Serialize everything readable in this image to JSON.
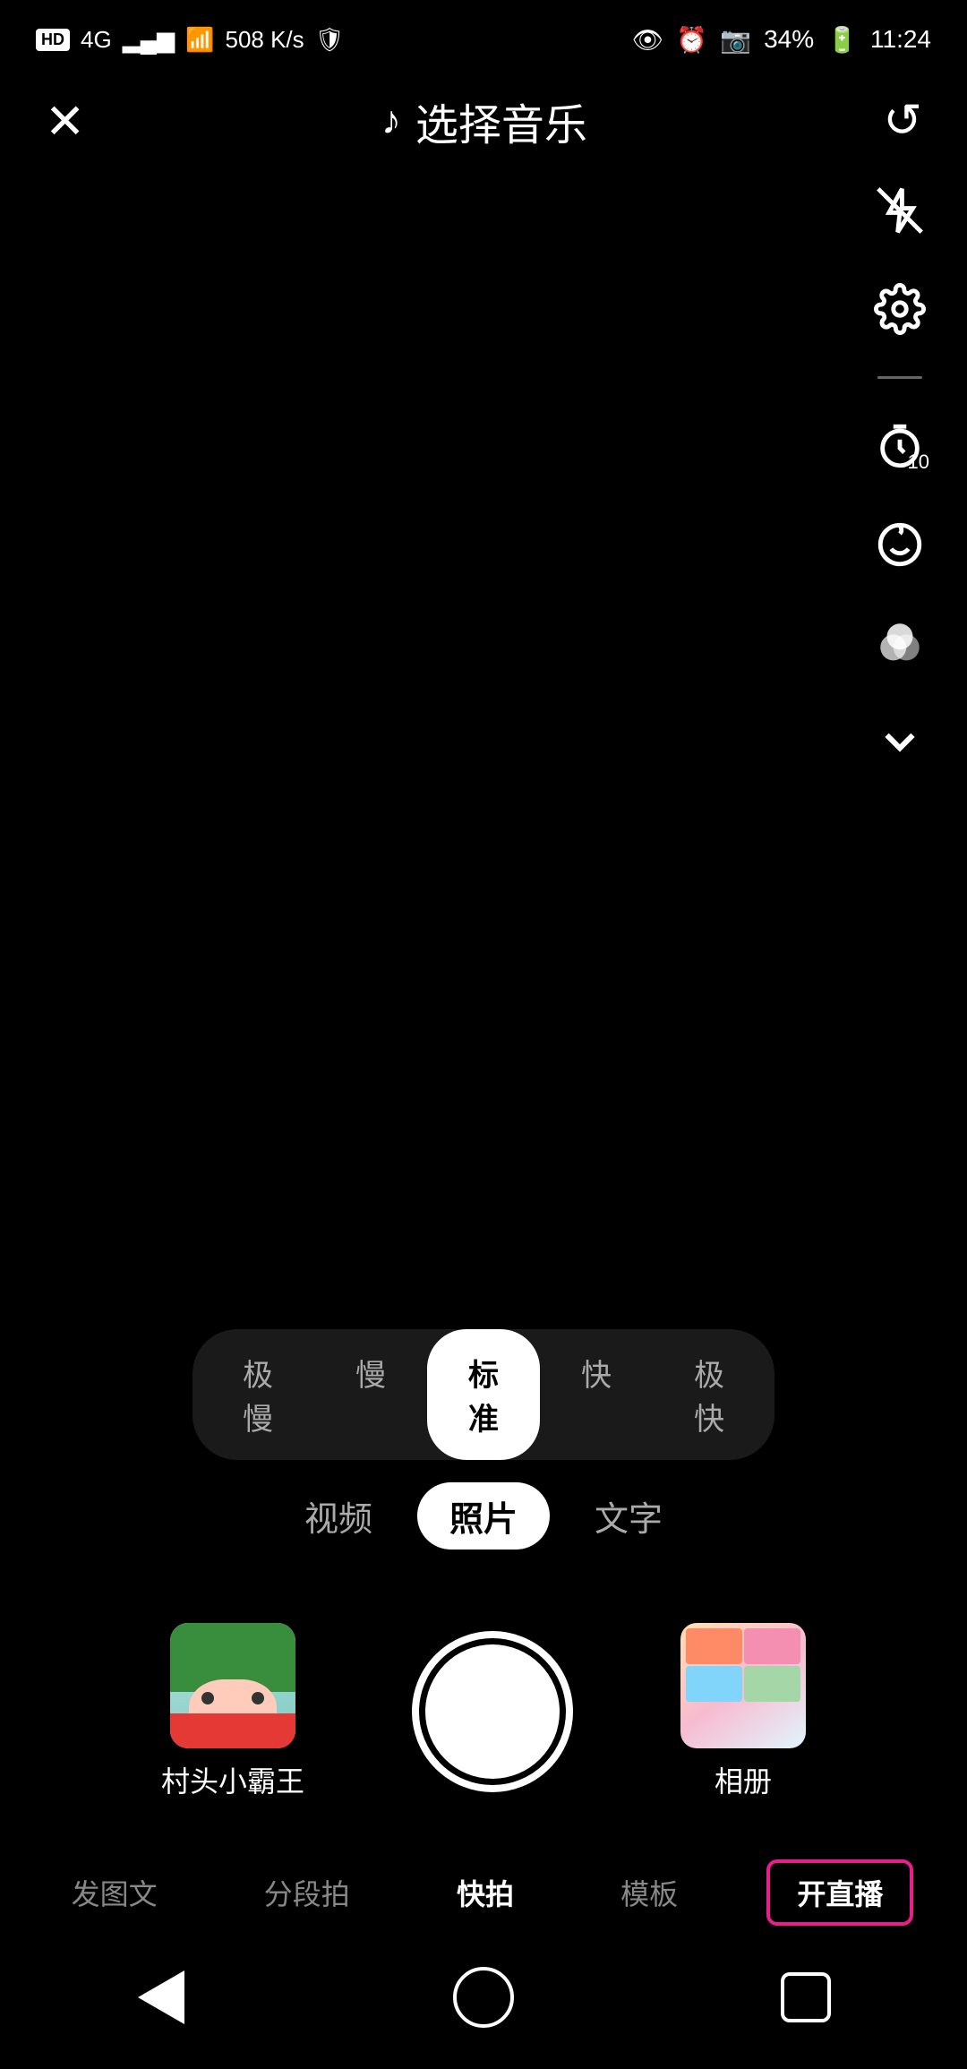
{
  "statusBar": {
    "left": {
      "hd": "HD",
      "network": "4G",
      "signal": "signal",
      "wifi": "wifi",
      "speed": "508 K/s",
      "shield": "shield"
    },
    "right": {
      "eye": "👁",
      "alarm": "⏰",
      "camera": "📷",
      "battery": "34%",
      "time": "11:24"
    }
  },
  "header": {
    "closeLabel": "✕",
    "musicIcon": "♪",
    "title": "选择音乐",
    "refreshIcon": "↺"
  },
  "sidebarIcons": {
    "flashOff": "flash-off",
    "settings": "settings",
    "timer": "timer-10",
    "beauty": "beauty",
    "colors": "colors",
    "chevron": "chevron-down"
  },
  "speedSelector": {
    "items": [
      {
        "label": "极慢",
        "active": false
      },
      {
        "label": "慢",
        "active": false
      },
      {
        "label": "标准",
        "active": true
      },
      {
        "label": "快",
        "active": false
      },
      {
        "label": "极快",
        "active": false
      }
    ]
  },
  "modeSelector": {
    "items": [
      {
        "label": "视频",
        "active": false
      },
      {
        "label": "照片",
        "active": true
      },
      {
        "label": "文字",
        "active": false
      }
    ]
  },
  "userAvatar": {
    "name": "村头小霸王"
  },
  "album": {
    "label": "相册"
  },
  "bottomTabs": {
    "items": [
      {
        "label": "发图文",
        "active": false
      },
      {
        "label": "分段拍",
        "active": false
      },
      {
        "label": "快拍",
        "active": true
      },
      {
        "label": "模板",
        "active": false
      },
      {
        "label": "开直播",
        "active": false,
        "highlighted": true
      }
    ]
  },
  "navBar": {
    "back": "back",
    "home": "home",
    "recent": "recent"
  }
}
